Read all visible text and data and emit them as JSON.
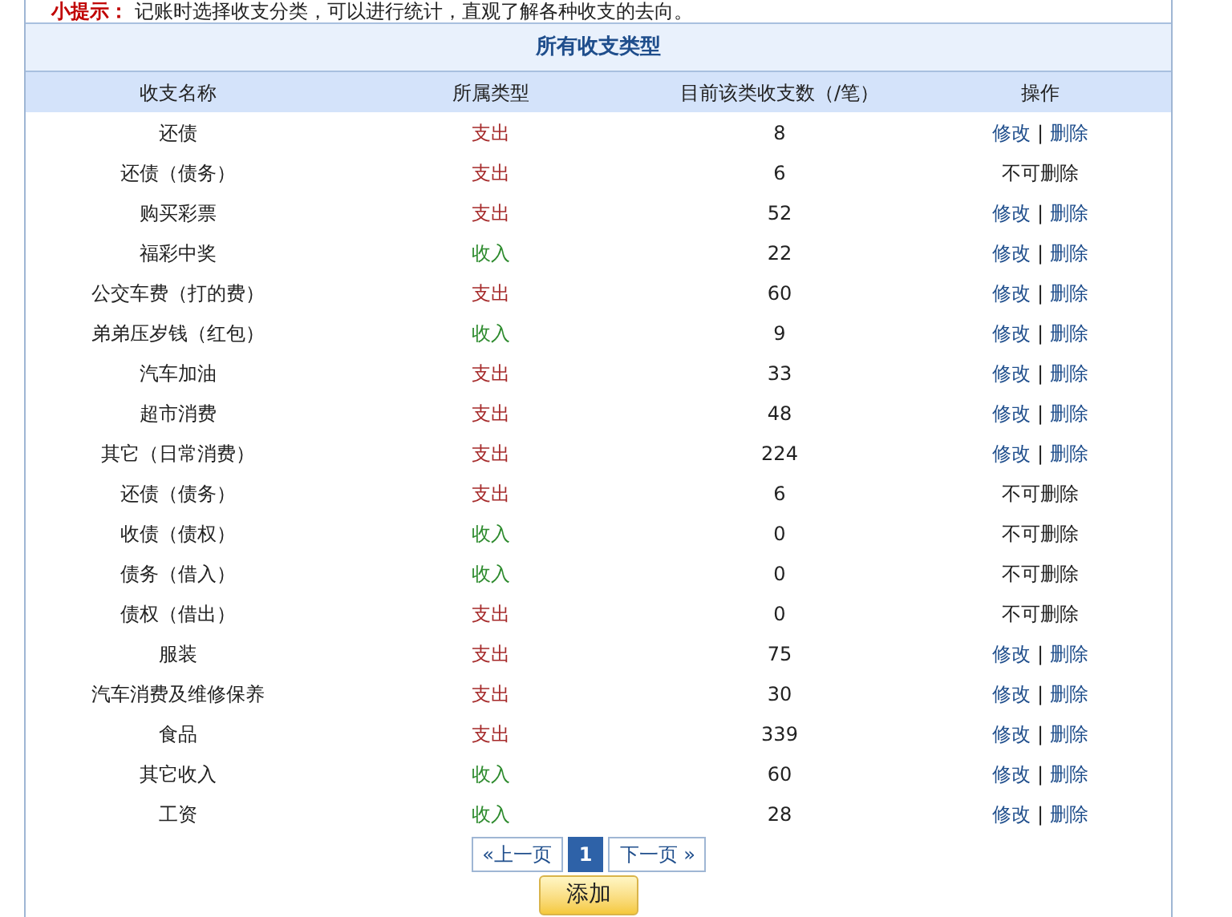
{
  "tip": {
    "label": "小提示：",
    "text": "记账时选择收支分类，可以进行统计，直观了解各种收支的去向。"
  },
  "table": {
    "title": "所有收支类型",
    "columns": [
      "收支名称",
      "所属类型",
      "目前该类收支数（/笔）",
      "操作"
    ],
    "rows": [
      {
        "name": "还债",
        "type": {
          "text": "支出",
          "kind": "expense"
        },
        "count": "8",
        "action": {
          "kind": "links",
          "edit": "修改",
          "separator": "|",
          "delete": "删除"
        }
      },
      {
        "name": "还债（债务）",
        "type": {
          "text": "支出",
          "kind": "expense"
        },
        "count": "6",
        "action": {
          "kind": "locked",
          "text": "不可删除"
        }
      },
      {
        "name": "购买彩票",
        "type": {
          "text": "支出",
          "kind": "expense"
        },
        "count": "52",
        "action": {
          "kind": "links",
          "edit": "修改",
          "separator": "|",
          "delete": "删除"
        }
      },
      {
        "name": "福彩中奖",
        "type": {
          "text": "收入",
          "kind": "income"
        },
        "count": "22",
        "action": {
          "kind": "links",
          "edit": "修改",
          "separator": "|",
          "delete": "删除"
        }
      },
      {
        "name": "公交车费（打的费）",
        "type": {
          "text": "支出",
          "kind": "expense"
        },
        "count": "60",
        "action": {
          "kind": "links",
          "edit": "修改",
          "separator": "|",
          "delete": "删除"
        }
      },
      {
        "name": "弟弟压岁钱（红包）",
        "type": {
          "text": "收入",
          "kind": "income"
        },
        "count": "9",
        "action": {
          "kind": "links",
          "edit": "修改",
          "separator": "|",
          "delete": "删除"
        }
      },
      {
        "name": "汽车加油",
        "type": {
          "text": "支出",
          "kind": "expense"
        },
        "count": "33",
        "action": {
          "kind": "links",
          "edit": "修改",
          "separator": "|",
          "delete": "删除"
        }
      },
      {
        "name": "超市消费",
        "type": {
          "text": "支出",
          "kind": "expense"
        },
        "count": "48",
        "action": {
          "kind": "links",
          "edit": "修改",
          "separator": "|",
          "delete": "删除"
        }
      },
      {
        "name": "其它（日常消费）",
        "type": {
          "text": "支出",
          "kind": "expense"
        },
        "count": "224",
        "action": {
          "kind": "links",
          "edit": "修改",
          "separator": "|",
          "delete": "删除"
        }
      },
      {
        "name": "还债（债务）",
        "type": {
          "text": "支出",
          "kind": "expense"
        },
        "count": "6",
        "action": {
          "kind": "locked",
          "text": "不可删除"
        }
      },
      {
        "name": "收债（债权）",
        "type": {
          "text": "收入",
          "kind": "income"
        },
        "count": "0",
        "action": {
          "kind": "locked",
          "text": "不可删除"
        }
      },
      {
        "name": "债务（借入）",
        "type": {
          "text": "收入",
          "kind": "income"
        },
        "count": "0",
        "action": {
          "kind": "locked",
          "text": "不可删除"
        }
      },
      {
        "name": "债权（借出）",
        "type": {
          "text": "支出",
          "kind": "expense"
        },
        "count": "0",
        "action": {
          "kind": "locked",
          "text": "不可删除"
        }
      },
      {
        "name": "服装",
        "type": {
          "text": "支出",
          "kind": "expense"
        },
        "count": "75",
        "action": {
          "kind": "links",
          "edit": "修改",
          "separator": "|",
          "delete": "删除"
        }
      },
      {
        "name": "汽车消费及维修保养",
        "type": {
          "text": "支出",
          "kind": "expense"
        },
        "count": "30",
        "action": {
          "kind": "links",
          "edit": "修改",
          "separator": "|",
          "delete": "删除"
        }
      },
      {
        "name": "食品",
        "type": {
          "text": "支出",
          "kind": "expense"
        },
        "count": "339",
        "action": {
          "kind": "links",
          "edit": "修改",
          "separator": "|",
          "delete": "删除"
        }
      },
      {
        "name": "其它收入",
        "type": {
          "text": "收入",
          "kind": "income"
        },
        "count": "60",
        "action": {
          "kind": "links",
          "edit": "修改",
          "separator": "|",
          "delete": "删除"
        }
      },
      {
        "name": "工资",
        "type": {
          "text": "收入",
          "kind": "income"
        },
        "count": "28",
        "action": {
          "kind": "links",
          "edit": "修改",
          "separator": "|",
          "delete": "删除"
        }
      }
    ]
  },
  "pagination": {
    "prev": "«上一页",
    "pages": [
      {
        "label": "1",
        "selected": true
      }
    ],
    "next": "下一页 »"
  },
  "add_button": "添加"
}
